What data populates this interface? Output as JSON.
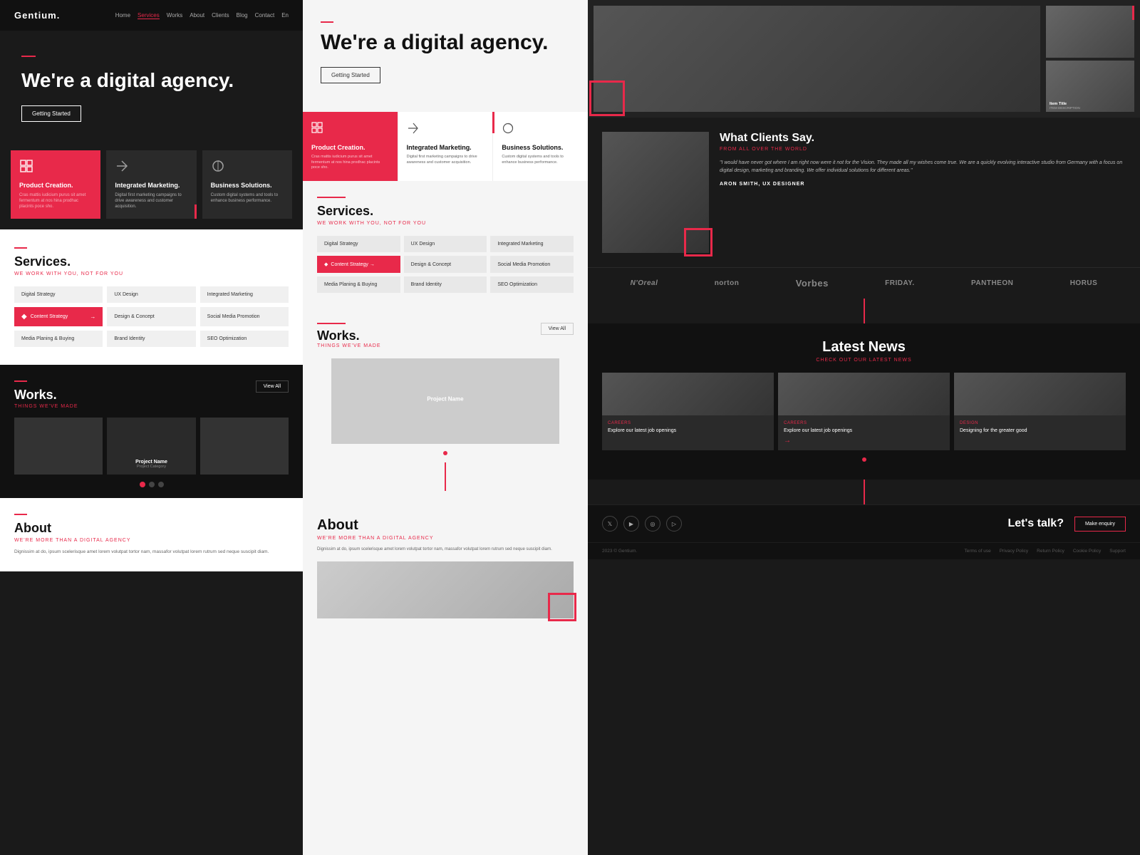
{
  "brand": {
    "logo": "Gentium.",
    "tagline": "We're a digital agency."
  },
  "nav": {
    "links": [
      "Home",
      "Services",
      "Works",
      "About",
      "Clients",
      "Blog",
      "Contact",
      "En"
    ]
  },
  "hero": {
    "title": "We're a digital agency.",
    "cta": "Getting Started"
  },
  "cards": [
    {
      "title": "Product Creation.",
      "text": "Cras mattis iudicium purus sit amet fermentum at nos hina prodhac placints poce sho.",
      "type": "red"
    },
    {
      "title": "Integrated Marketing.",
      "text": "Digital first marketing campaigns to drive awareness and customer acquisition.",
      "type": "dark"
    },
    {
      "title": "Business Solutions.",
      "text": "Custom digital systems and tools to enhance business performance.",
      "type": "dark"
    }
  ],
  "services": {
    "title": "Services.",
    "subtitle": "WE WORK WITH YOU, NOT FOR YOU",
    "items": [
      "Digital Strategy",
      "UX Design",
      "Integrated Marketing",
      "Content Strategy",
      "Design & Concept",
      "Social Media Promotion",
      "Media Planing & Buying",
      "Brand Identity",
      "SEO Optimization"
    ],
    "active": "Content Strategy"
  },
  "works": {
    "title": "Works.",
    "subtitle": "THINGS WE'VE MADE",
    "view_all": "View All",
    "project": {
      "name": "Project Name",
      "category": "Project Category"
    },
    "dots": [
      true,
      false,
      false
    ]
  },
  "about": {
    "title": "About",
    "subtitle": "WE'RE MORE THAN A DIGITAL AGENCY",
    "text": "Dignissim at do, ipsum scelerisque amet lorem volutpat tortor nam, massafor volutpat lorem rutrum sed neque suscipit diam."
  },
  "testimonial": {
    "title": "What Clients Say.",
    "subtitle": "FROM ALL OVER THE WORLD",
    "quote": "\"I would have never got where I am right now were it not for the Vision. They made all my wishes come true. We are a quickly evolving interactive studio from Germany with a focus on digital design, marketing and branding. We offer individual solutions for different areas.\"",
    "author": "ARON SMITH, UX DESIGNER"
  },
  "brands": [
    "N'Oreal",
    "norton",
    "Vorbes",
    "FRIDAY.",
    "PANTHEON",
    "HORUS"
  ],
  "latest_news": {
    "title": "Latest News",
    "subtitle": "CHECK OUT OUR LATEST NEWS",
    "items": [
      {
        "category": "CAREERS",
        "title": "Explore our latest job openings"
      },
      {
        "category": "CAREERS",
        "title": "Explore our latest job openings"
      },
      {
        "category": "DESIGN",
        "title": "Designing for the greater good"
      }
    ]
  },
  "footer": {
    "cta_text": "Let's talk?",
    "cta_btn": "Make enquiry",
    "socials": [
      "𝕏",
      "▶",
      "◎",
      "▷"
    ],
    "copyright": "2023 © Gentium.",
    "links": [
      "Terms of use",
      "Privacy Policy",
      "Return Policy",
      "Cookie Policy",
      "Support"
    ]
  },
  "mid_hero": {
    "title": "We're a digital agency.",
    "cta": "Getting Started"
  }
}
